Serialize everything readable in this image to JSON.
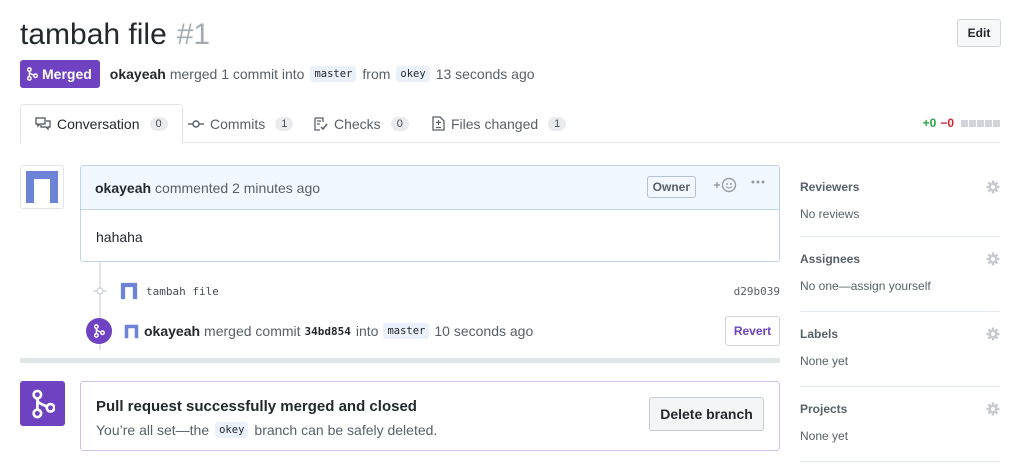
{
  "header": {
    "title": "tambah file",
    "number": "#1",
    "edit_label": "Edit"
  },
  "meta": {
    "badge_label": "Merged",
    "author": "okayeah",
    "merged_text": "merged 1 commit into",
    "base_branch": "master",
    "from_text": "from",
    "head_branch": "okey",
    "time": "13 seconds ago"
  },
  "tabs": [
    {
      "label": "Conversation",
      "count": "0",
      "icon": "comment-discussion-icon"
    },
    {
      "label": "Commits",
      "count": "1",
      "icon": "git-commit-icon"
    },
    {
      "label": "Checks",
      "count": "0",
      "icon": "checklist-icon"
    },
    {
      "label": "Files changed",
      "count": "1",
      "icon": "file-diff-icon"
    }
  ],
  "diffstat": {
    "additions": "+0",
    "deletions": "−0"
  },
  "comment": {
    "author": "okayeah",
    "action_text": "commented 2 minutes ago",
    "owner_label": "Owner",
    "body": "hahaha"
  },
  "commit": {
    "message": "tambah file",
    "sha": "d29b039"
  },
  "merge_event": {
    "author": "okayeah",
    "text_1": "merged commit",
    "sha": "34bd854",
    "text_2": "into",
    "branch": "master",
    "time": "10 seconds ago",
    "revert_label": "Revert"
  },
  "merge_box": {
    "title": "Pull request successfully merged and closed",
    "desc_1": "You’re all set—the",
    "branch": "okey",
    "desc_2": "branch can be safely deleted.",
    "delete_label": "Delete branch"
  },
  "sidebar": [
    {
      "title": "Reviewers",
      "value": "No reviews"
    },
    {
      "title": "Assignees",
      "value": "No one—assign yourself"
    },
    {
      "title": "Labels",
      "value": "None yet"
    },
    {
      "title": "Projects",
      "value": "None yet"
    }
  ],
  "colors": {
    "merged_purple": "#6f42c1",
    "addition_green": "#28a745",
    "deletion_red": "#cb2431"
  }
}
